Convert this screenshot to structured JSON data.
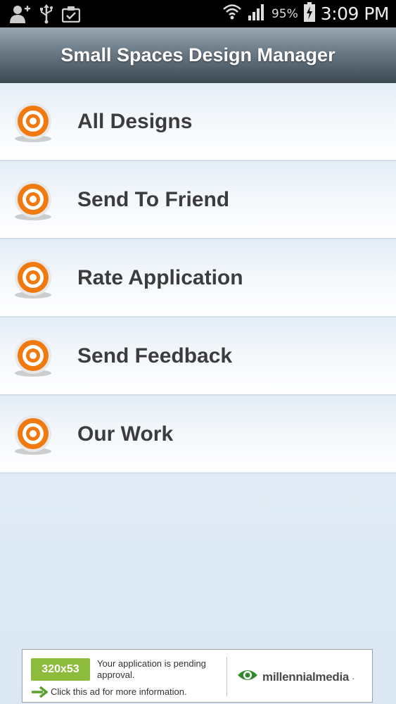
{
  "status_bar": {
    "battery_percent": "95%",
    "time": "3:09 PM",
    "icons": [
      "add-contact-icon",
      "usb-icon",
      "clipboard-check-icon",
      "wifi-icon",
      "signal-icon",
      "battery-charging-icon"
    ]
  },
  "app": {
    "title": "Small Spaces Design Manager"
  },
  "menu": {
    "items": [
      {
        "label": "All Designs",
        "icon": "target-icon"
      },
      {
        "label": "Send To Friend",
        "icon": "target-icon"
      },
      {
        "label": "Rate Application",
        "icon": "target-icon"
      },
      {
        "label": "Send Feedback",
        "icon": "target-icon"
      },
      {
        "label": "Our Work",
        "icon": "target-icon"
      }
    ]
  },
  "ad": {
    "size_badge": "320x53",
    "message": "Your application is pending approval.",
    "click_text": "Click this ad for more information.",
    "brand": "millennialmedia",
    "brand_mark": ".",
    "colors": {
      "badge": "#8dbb3c",
      "logo": "#2f8a2f"
    }
  },
  "colors": {
    "menu_text": "#3c3c3c",
    "icon_orange": "#f07a10"
  }
}
